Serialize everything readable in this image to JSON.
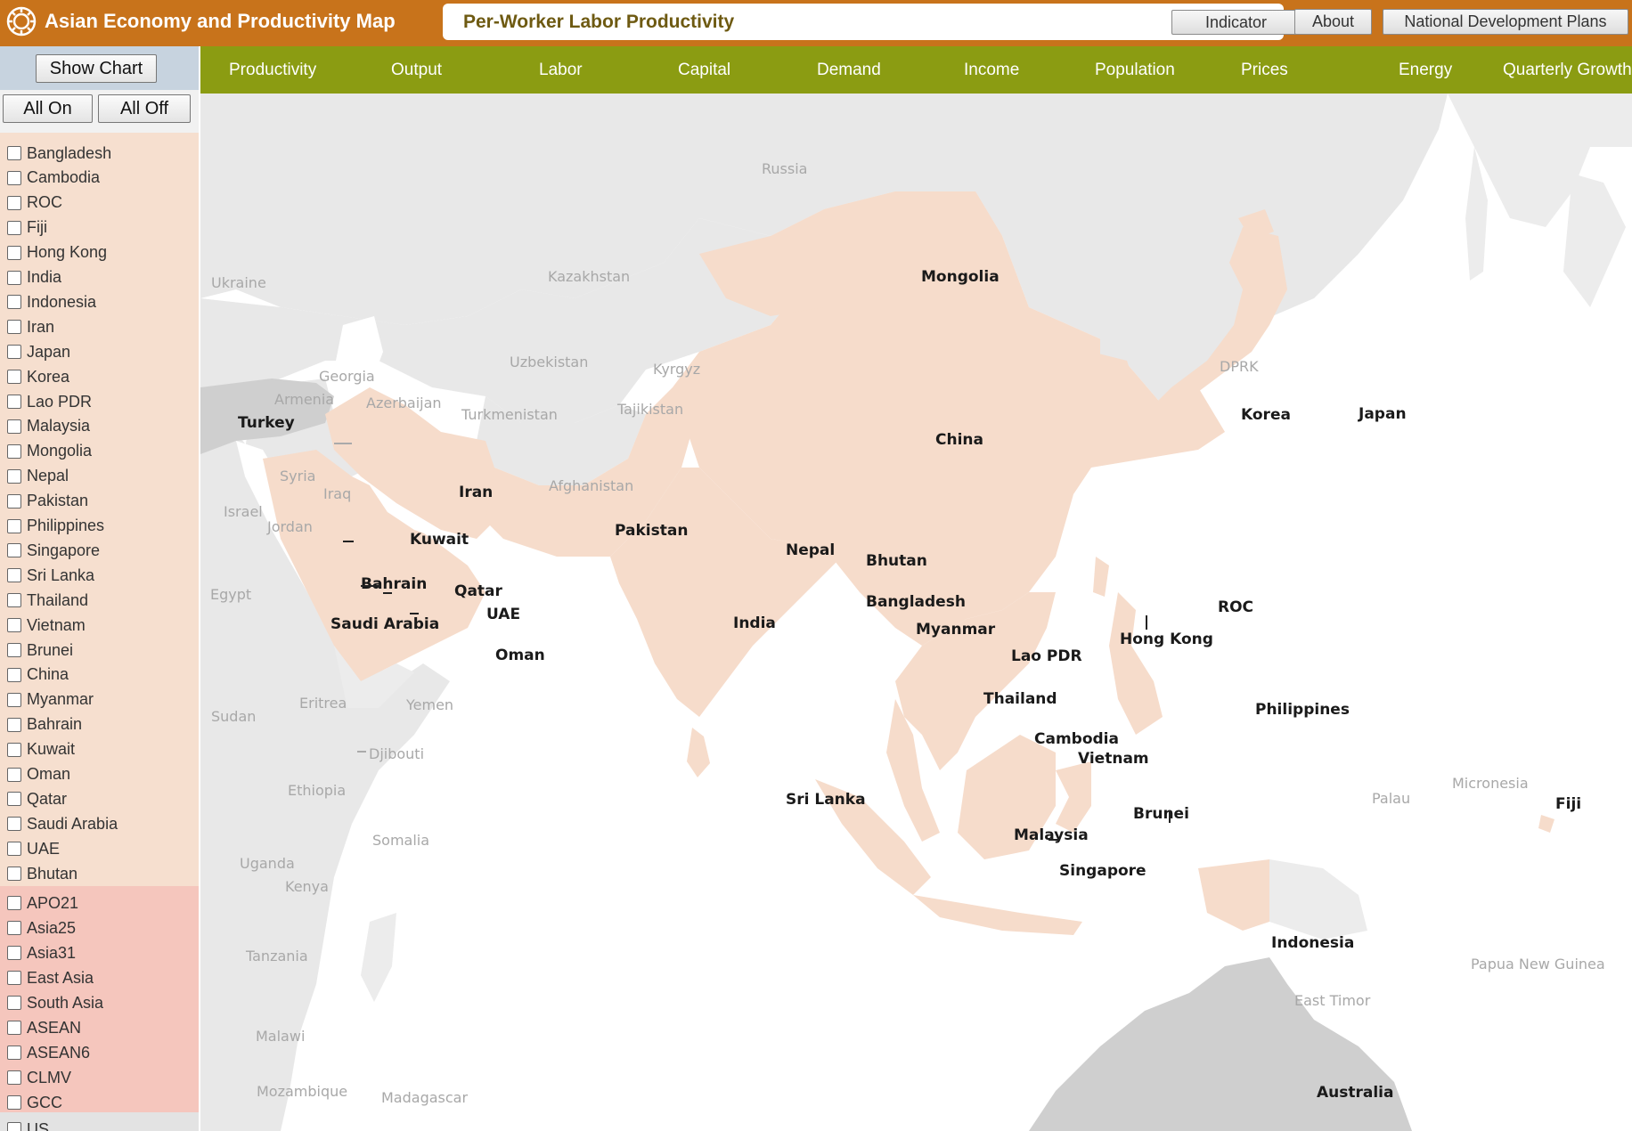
{
  "header": {
    "app_title": "Asian Economy and Productivity Map",
    "indicator_title": "Per-Worker Labor Productivity",
    "indicator_button": "Indicator",
    "about_button": "About",
    "ndp_button": "National Development Plans"
  },
  "nav": {
    "items": [
      "Productivity",
      "Output",
      "Labor",
      "Capital",
      "Demand",
      "Income",
      "Population",
      "Prices",
      "Energy",
      "Quarterly Growth"
    ]
  },
  "sidebar": {
    "show_chart": "Show Chart",
    "all_on": "All On",
    "all_off": "All Off",
    "countries": [
      "Bangladesh",
      "Cambodia",
      "ROC",
      "Fiji",
      "Hong Kong",
      "India",
      "Indonesia",
      "Iran",
      "Japan",
      "Korea",
      "Lao PDR",
      "Malaysia",
      "Mongolia",
      "Nepal",
      "Pakistan",
      "Philippines",
      "Singapore",
      "Sri Lanka",
      "Thailand",
      "Vietnam",
      "Brunei",
      "China",
      "Myanmar",
      "Bahrain",
      "Kuwait",
      "Oman",
      "Qatar",
      "Saudi Arabia",
      "UAE",
      "Bhutan"
    ],
    "regions": [
      "APO21",
      "Asia25",
      "Asia31",
      "East Asia",
      "South Asia",
      "ASEAN",
      "ASEAN6",
      "CLMV",
      "GCC"
    ],
    "others": [
      "US"
    ]
  },
  "map": {
    "colors": {
      "member": "#f6dccb",
      "other": "#e8e8e8",
      "highlight": "#cfcfcf",
      "sea": "#ffffff"
    },
    "member_labels": [
      "Mongolia",
      "China",
      "Korea",
      "Japan",
      "Iran",
      "Pakistan",
      "Nepal",
      "Bhutan",
      "Bangladesh",
      "India",
      "Myanmar",
      "Lao PDR",
      "Thailand",
      "Cambodia",
      "Vietnam",
      "Hong Kong",
      "ROC",
      "Philippines",
      "Malaysia",
      "Singapore",
      "Brunei",
      "Indonesia",
      "Sri Lanka",
      "Kuwait",
      "Bahrain",
      "Qatar",
      "UAE",
      "Saudi Arabia",
      "Oman",
      "Fiji"
    ],
    "highlight_labels": [
      "Turkey",
      "Australia"
    ],
    "other_labels": [
      "Russia",
      "Ukraine",
      "Kazakhstan",
      "Uzbekistan",
      "Kyrgyz",
      "Georgia",
      "Armenia",
      "Azerbaijan",
      "Turkmenistan",
      "Tajikistan",
      "DPRK",
      "Syria",
      "Iraq",
      "Afghanistan",
      "Israel",
      "Jordan",
      "Egypt",
      "Sudan",
      "Eritrea",
      "Yemen",
      "Djibouti",
      "Ethiopia",
      "Somalia",
      "Uganda",
      "Kenya",
      "Tanzania",
      "Malawi",
      "Mozambique",
      "Madagascar",
      "Palau",
      "Micronesia",
      "Papua New Guinea",
      "East Timor"
    ]
  }
}
